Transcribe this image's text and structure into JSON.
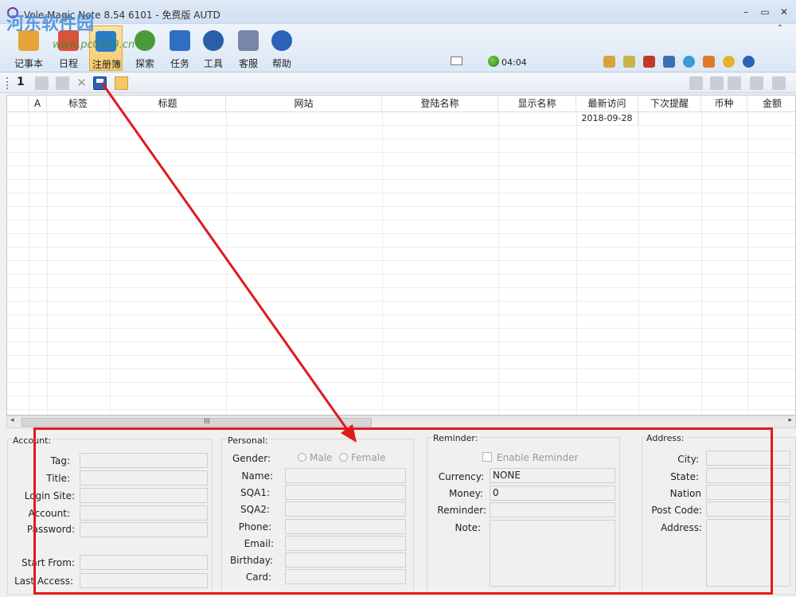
{
  "window": {
    "title": "Vole Magic Note 8.54 6101 - 免费版 AUTD",
    "controls": [
      "–",
      "▭",
      "✕"
    ]
  },
  "watermark": {
    "line1": "河东软件园",
    "line2": "www.pc0359.cn"
  },
  "ribbon": {
    "tabs": [
      {
        "label": "记事本",
        "icon": "notebook-icon",
        "color": "#e7a33a"
      },
      {
        "label": "日程",
        "icon": "calendar-icon",
        "color": "#d9533a"
      },
      {
        "label": "注册簿",
        "icon": "registry-book-icon",
        "color": "#2b7bc9",
        "active": true
      },
      {
        "label": "探索",
        "icon": "explore-icon",
        "color": "#4a9a3c"
      },
      {
        "label": "任务",
        "icon": "task-list-icon",
        "color": "#2f6fc1"
      },
      {
        "label": "工具",
        "icon": "gear-tools-icon",
        "color": "#2a5fa8"
      },
      {
        "label": "客服",
        "icon": "support-icon",
        "color": "#7a86a8"
      },
      {
        "label": "帮助",
        "icon": "help-icon",
        "color": "#2d62b8"
      }
    ],
    "clock": "04:04",
    "collapse_glyph": "⌃"
  },
  "toolbar": {
    "page_number": "1",
    "delete_glyph": "✕"
  },
  "grid": {
    "columns": [
      "",
      "A",
      "标签",
      "标题",
      "网站",
      "登陆名称",
      "显示名称",
      "最新访问",
      "下次提醒",
      "币种",
      "金额"
    ],
    "rows": [
      [
        "",
        "",
        "",
        "",
        "",
        "",
        "",
        "2018-09-28",
        "",
        "",
        ""
      ]
    ],
    "scroll_grip": "III",
    "scroll_left": "◂",
    "scroll_right": "▸"
  },
  "account": {
    "title": "Account:",
    "fields": [
      {
        "label": "Tag:",
        "value": ""
      },
      {
        "label": "Title:",
        "value": ""
      },
      {
        "label": "Login Site:",
        "value": ""
      },
      {
        "label": "Account:",
        "value": ""
      },
      {
        "label": "Password:",
        "value": ""
      }
    ],
    "start_from_label": "Start From:",
    "last_access_label": "Last Access:"
  },
  "personal": {
    "title": "Personal:",
    "gender_label": "Gender:",
    "male": "Male",
    "female": "Female",
    "fields": [
      {
        "label": "Name:",
        "value": ""
      },
      {
        "label": "SQA1:",
        "value": ""
      },
      {
        "label": "SQA2:",
        "value": ""
      },
      {
        "label": "Phone:",
        "value": ""
      },
      {
        "label": "Email:",
        "value": ""
      },
      {
        "label": "Birthday:",
        "value": ""
      },
      {
        "label": "Card:",
        "value": ""
      }
    ]
  },
  "reminder": {
    "title": "Reminder:",
    "enable_label": "Enable Reminder",
    "currency_label": "Currency:",
    "currency_value": "NONE",
    "money_label": "Money:",
    "money_value": "0",
    "reminder_label": "Reminder:",
    "note_label": "Note:"
  },
  "address": {
    "title": "Address:",
    "fields": [
      {
        "label": "City:",
        "value": ""
      },
      {
        "label": "State:",
        "value": ""
      },
      {
        "label": "Nation",
        "value": ""
      },
      {
        "label": "Post Code:",
        "value": ""
      },
      {
        "label": "Address:",
        "value": ""
      }
    ]
  },
  "colors": {
    "annotation_red": "#e01a1a",
    "active_tab": "#f7c76a"
  }
}
